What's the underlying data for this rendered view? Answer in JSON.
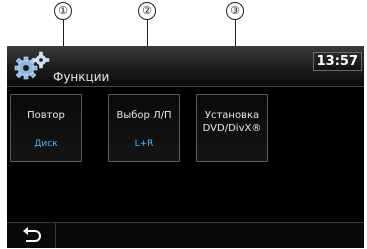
{
  "callouts": [
    "①",
    "②",
    "③"
  ],
  "header": {
    "title": "Функции",
    "clock": "13:57"
  },
  "panels": [
    {
      "label": "Повтор",
      "value": "Диск"
    },
    {
      "label": "Выбор Л/П",
      "value": "L+R"
    },
    {
      "label": "Установка DVD/DivX®",
      "value": ""
    }
  ],
  "icons": {
    "header": "gear-icon",
    "back": "back-arrow-icon"
  },
  "colors": {
    "value_text": "#49b8ff"
  }
}
